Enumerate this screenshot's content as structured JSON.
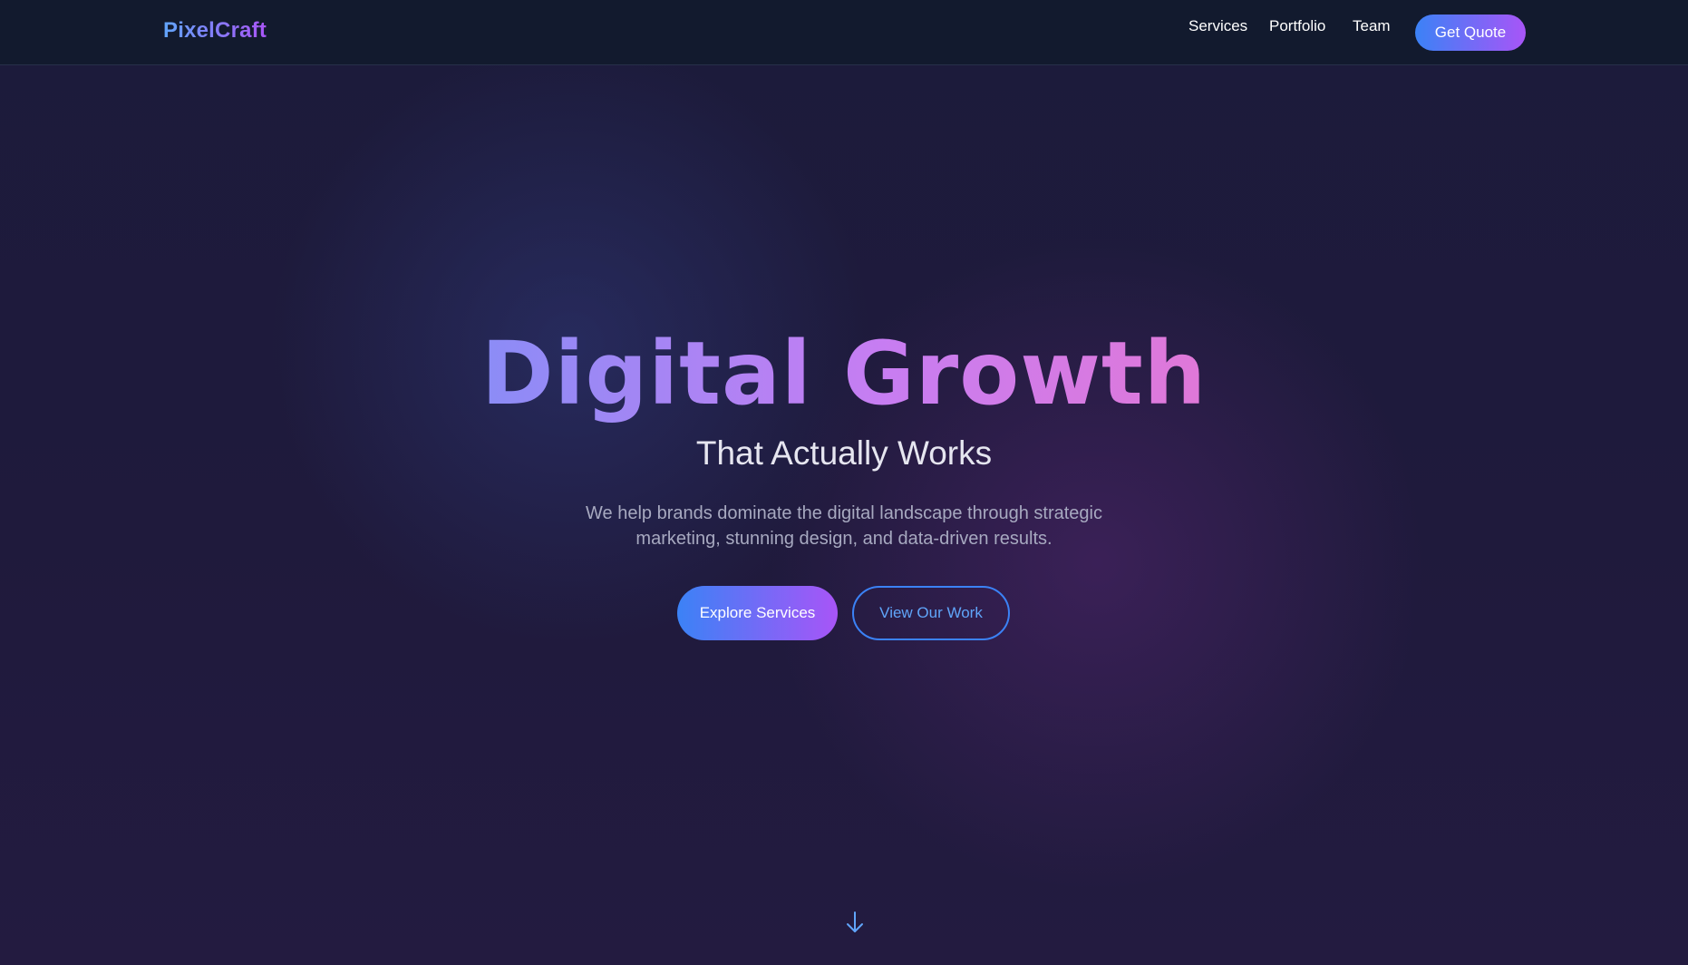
{
  "nav": {
    "logo": "PixelCraft",
    "links": [
      "Services",
      "Portfolio",
      "Team"
    ],
    "cta": "Get Quote"
  },
  "hero": {
    "title": "Digital Growth",
    "subtitle": "That Actually Works",
    "description": "We help brands dominate the digital landscape through strategic marketing, stunning design, and data-driven results.",
    "primary_button": "Explore Services",
    "secondary_button": "View Our Work",
    "scroll_icon": "arrow-down-icon"
  },
  "colors": {
    "accent_blue": "#3b82f6",
    "accent_purple": "#a855f7",
    "navbar_bg": "#121a2e",
    "page_bg": "#1e1a3a"
  }
}
